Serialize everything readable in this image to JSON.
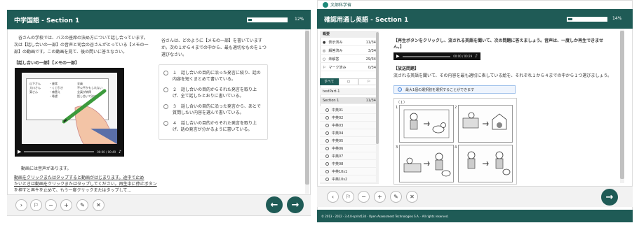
{
  "left": {
    "title": "中学国語 - Section 1",
    "progress_pct": "12%",
    "progress_value": 0.12,
    "passage_lines": [
      "　谷さんの学校では、バスの座席の決め方について話し合っています。",
      "次は【話し合いの一部】の音声と司会の谷さんがとっている【メモの一",
      "部】の動画です。この動画を見て、後の問いに答えなさい。"
    ],
    "video_caption": "【話し合いの一部】【メモの一部】",
    "video_time": "00:00 / 00:49",
    "memo_names": [
      "山下さん",
      "大川さん",
      "東さん"
    ],
    "memo_notes": [
      "・座席",
      "・くじ引き",
      "・席替え",
      "・希望"
    ],
    "memo_right": [
      "全員",
      "不公平かもしれない",
      "全員が納得",
      "話し合いで決める"
    ],
    "question_lines": [
      "谷さんは、どのように【メモの一部】を書いていますか。次の１から４までの中から、最も適切なものを１つ選びなさい。"
    ],
    "options": [
      "１　話し合いの目的に沿った発言に絞り、話の内容を短くまとめて書いている。",
      "２　話し合いの目的からそれた発言を取り上げ、全て話したとおりに書いている。",
      "３　話し合いの目的に沿った発言から、あとで質問したい内容を選んで書いている。",
      "４　話し合いの目的からそれた発言を取り上げ、話の発言が分かるように書いている。"
    ],
    "note_lines": [
      "動画には音声があります。",
      "動画をクリックまたはタップすると動画がはじまります。途中で止め",
      "たいときは動画をクリックまたはタップしてください。再生中に停止ボタン",
      "を押すと再生を止めて、もう一度クリックまたはタップして..."
    ]
  },
  "right": {
    "brand": "文部科学省",
    "title": "確認用通し英語 - Section 1",
    "progress_pct": "14%",
    "progress_value": 0.14,
    "sidebar_header": "概要",
    "sidebar_stats": [
      {
        "icon": "●",
        "label": "表示済み",
        "count": "11/34"
      },
      {
        "icon": "◎",
        "label": "解答済み",
        "count": "3/34"
      },
      {
        "icon": "○",
        "label": "未解答",
        "count": "29/34"
      },
      {
        "icon": "⚐",
        "label": "マーク済み",
        "count": "0/34"
      }
    ],
    "filter_tabs": [
      "すべて",
      "○",
      "⚐"
    ],
    "part_label": "testPart-1",
    "section_label": "Section 1",
    "section_count": "11/34",
    "questions": [
      "中英01",
      "中英02",
      "中英03",
      "中英04",
      "中英05",
      "中英06",
      "中英07",
      "中英08",
      "中英10s1",
      "中英10s2",
      "中英10s3"
    ],
    "instruction_lines": [
      "【再生ボタンをクリックし、流される英語を聞いて、次の問題に答えましょう。音声は、一度しか再生できませ",
      "ん。】"
    ],
    "audio_time": "00:00 / 00:29",
    "problem_label": "【放送問題】",
    "problem_text": "流される英語を聞いて、その内容を最も適切に表している絵を、それぞれ１から４までの中から１つ選びましょう。",
    "info_text": "最大1個の選択肢を選択することができます",
    "image_caption": "（１）",
    "image_numbers": [
      "1",
      "2",
      "3",
      "4"
    ],
    "footer_text": "© 2013 - 2022 · 3.4.0-sprint134 · Open Assessment Technologies S.A. · All rights reserved."
  },
  "toolbar_icons": [
    "arrow-right-icon",
    "flag-icon",
    "zoom-out-icon",
    "zoom-in-icon",
    "highlighter-icon",
    "eliminator-icon"
  ],
  "toolbar_glyphs": [
    "›",
    "⚐",
    "−",
    "+",
    "✎",
    "✕"
  ],
  "right_toolbar_glyphs": [
    "‹",
    "⚐",
    "−",
    "+",
    "✎",
    "✕"
  ],
  "nav_glyphs": {
    "prev": "←",
    "next": "→"
  },
  "colors": {
    "brand": "#1f5b56",
    "info": "#3a7bd5"
  }
}
